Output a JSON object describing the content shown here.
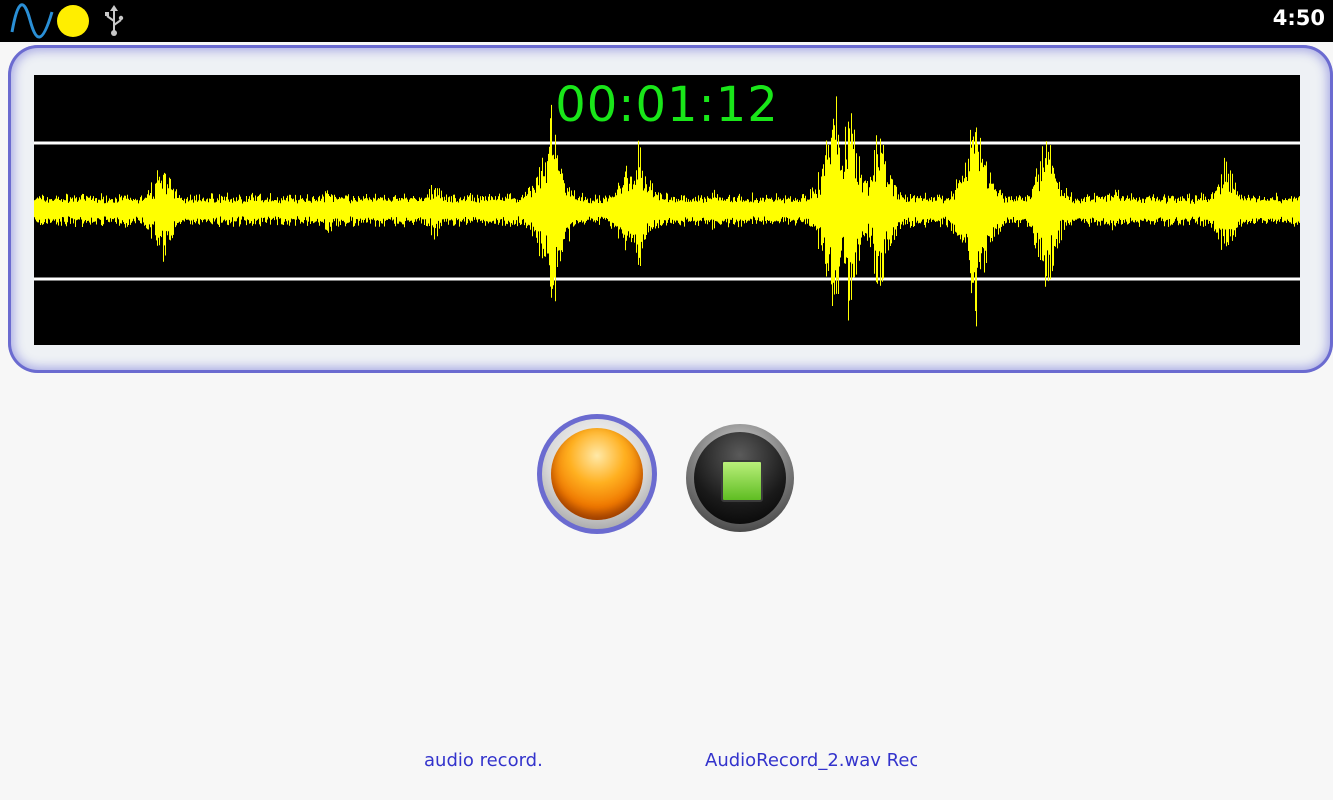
{
  "status_bar": {
    "clock": "4:50",
    "icons": [
      "waveform-app-icon",
      "yellow-dot-icon",
      "usb-icon"
    ],
    "wave_color": "#2a8fd6",
    "dot_color": "#ffee00"
  },
  "recorder": {
    "elapsed_time": "00:01:12",
    "timer_color": "#19e619",
    "waveform_color": "#ffff00",
    "guide_line_color": "#ffffff"
  },
  "controls": {
    "record_button": "record",
    "stop_button": "stop"
  },
  "footer": {
    "status_text": "audio record.",
    "file_text": "AudioRecord_2.wav  Recording"
  }
}
